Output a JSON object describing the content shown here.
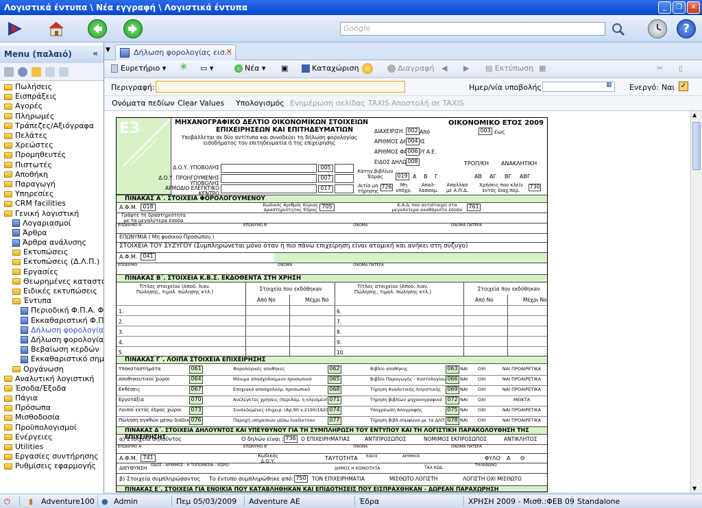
{
  "window": {
    "title": "Λογιστικά έντυπα \\ Νέα εγγραφή \\ Λογιστικά έντυπα"
  },
  "search": {
    "placeholder": "Google"
  },
  "sidebar": {
    "header": "Menu (παλαιό)",
    "items": [
      {
        "label": "Πωλήσεις",
        "level": 0,
        "type": "folder"
      },
      {
        "label": "Εισπράξεις",
        "level": 0,
        "type": "folder"
      },
      {
        "label": "Αγορές",
        "level": 0,
        "type": "folder"
      },
      {
        "label": "Πληρωμές",
        "level": 0,
        "type": "folder"
      },
      {
        "label": "Τράπεζες/Αξιόγραφα",
        "level": 0,
        "type": "folder"
      },
      {
        "label": "Πελάτες",
        "level": 0,
        "type": "folder"
      },
      {
        "label": "Χρεώστες",
        "level": 0,
        "type": "folder"
      },
      {
        "label": "Προμηθευτές",
        "level": 0,
        "type": "folder"
      },
      {
        "label": "Πιστωτές",
        "level": 0,
        "type": "folder"
      },
      {
        "label": "Αποθήκη",
        "level": 0,
        "type": "folder"
      },
      {
        "label": "Παραγωγή",
        "level": 0,
        "type": "folder"
      },
      {
        "label": "Υπηρεσίες",
        "level": 0,
        "type": "folder"
      },
      {
        "label": "CRM facilities",
        "level": 0,
        "type": "folder"
      },
      {
        "label": "Γενική λογιστική",
        "level": 0,
        "type": "folder"
      },
      {
        "label": "Λογαριασμοί",
        "level": 1,
        "type": "doc"
      },
      {
        "label": "Άρθρα",
        "level": 1,
        "type": "doc"
      },
      {
        "label": "Άρθρα ανάλυσης",
        "level": 1,
        "type": "doc"
      },
      {
        "label": "Εκτυπώσεις",
        "level": 1,
        "type": "folder"
      },
      {
        "label": "Εκτυπώσεις (Δ.Λ.Π.)",
        "level": 1,
        "type": "folder"
      },
      {
        "label": "Εργασίες",
        "level": 1,
        "type": "folder"
      },
      {
        "label": "Θεωρημένες καταστάσεις",
        "level": 1,
        "type": "folder"
      },
      {
        "label": "Ειδικές εκτυπώσεις",
        "level": 1,
        "type": "folder"
      },
      {
        "label": "Έντυπα",
        "level": 1,
        "type": "folder"
      },
      {
        "label": "Περιοδική Φ.Π.Α. Φ",
        "level": 2,
        "type": "doc"
      },
      {
        "label": "Εκκαθαριστική Φ.Π",
        "level": 2,
        "type": "doc"
      },
      {
        "label": "Δήλωση φορολογία",
        "level": 2,
        "type": "doc",
        "selected": true
      },
      {
        "label": "Δήλωση φορολογία",
        "level": 2,
        "type": "doc"
      },
      {
        "label": "Βεβαίωση κερδών",
        "level": 2,
        "type": "doc"
      },
      {
        "label": "Εκκαθαριστικό σημ",
        "level": 2,
        "type": "doc"
      },
      {
        "label": "Οργάνωση",
        "level": 1,
        "type": "folder"
      },
      {
        "label": "Αναλυτική λογιστική",
        "level": 0,
        "type": "folder"
      },
      {
        "label": "Έσοδα/Έξοδα",
        "level": 0,
        "type": "folder"
      },
      {
        "label": "Πάγια",
        "level": 0,
        "type": "folder"
      },
      {
        "label": "Πρόσωπα",
        "level": 0,
        "type": "folder"
      },
      {
        "label": "Μισθοδοσία",
        "level": 0,
        "type": "folder"
      },
      {
        "label": "Προϋπολογισμοί",
        "level": 0,
        "type": "folder"
      },
      {
        "label": "Ενέργειες",
        "level": 0,
        "type": "folder"
      },
      {
        "label": "Utilities",
        "level": 0,
        "type": "folder"
      },
      {
        "label": "Εργασίες συντήρησης",
        "level": 0,
        "type": "folder"
      },
      {
        "label": "Ρυθμίσεις εφαρμογής",
        "level": 0,
        "type": "folder"
      }
    ]
  },
  "tab": {
    "label": "Δήλωση φορολογίας εισ..."
  },
  "toolbar": {
    "index": "Ευρετήριο",
    "new": "Νέα",
    "save": "Καταχώριση",
    "delete": "Διαγραφή",
    "print": "Εκτύπωση"
  },
  "descbar": {
    "desc_label": "Περιγραφή:",
    "desc_value": "",
    "date_label": "Ημερ/νία υποβολής:",
    "date_value": "",
    "active_label": "Ενεργό:",
    "active_value": "Ναι"
  },
  "actions": {
    "field_names": "Ονόματα πεδίων",
    "clear": "Clear Values",
    "calc": "Υπολογισμός",
    "update_taxis": "Ενημέρωση σελίδας TAXIS",
    "send_taxis": "Αποστολή σε TAXIS"
  },
  "form": {
    "title1": "ΜΗΧΑΝΟΓΡΑΦΙΚΟ ΔΕΛΤΙΟ ΟΙΚΟΝΟΜΙΚΩΝ ΣΤΟΙΧΕΙΩΝ",
    "title2": "ΕΠΙΧΕΙΡΗΣΕΩΝ ΚΑΙ ΕΠΙΤΗΔΕΥΜΑΤΙΩΝ",
    "year": "ΟΙΚΟΝΟΜΙΚΟ ΕΤΟΣ 2009",
    "subtitle": "Υποβάλλεται σε δύο αντίτυπα και συνοδεύει τη δήλωση φορολογίας εισοδήματος του επιτηδευματία ή της επιχείρησης",
    "logo": "E3",
    "doy_labels": [
      "Δ.Ο.Υ. ΥΠΟΒΟΛΗΣ",
      "Δ.Ο.Υ. ΠΡΟΗΓΟΥΜΕΝΗΣ ΥΠΟΒΟΛΗΣ",
      "ΑΡΜΟΔΙΟ ΕΛΕΓΚΤΙΚΟ ΚΕΝΤΡΟ"
    ],
    "doy_codes": [
      "005",
      "007",
      "017"
    ],
    "right_labels": [
      "ΔΙΑΧΕΙΡΙΣΗ",
      "ΑΡΙΘΜΟΣ ΔΗΛΩΣΗΣ",
      "ΑΡΙΘΜΟΣ ΦΑΚΕΛΟΥ Α.Ε.",
      "ΕΙΔΟΣ ΔΗΛΩΣΗΣ"
    ],
    "right_codes": [
      "002",
      "004",
      "006",
      "008"
    ],
    "from": "Από",
    "to": "έως",
    "code003": "003",
    "tropikh": "ΤΡΟΠ/ΚΗ",
    "anaklitiki": "ΑΝΑΚΛΗΤΙΚΗ",
    "books_label": "Κατηγ.βιβλίων Έδρας",
    "books_code": "019",
    "books_cats": [
      "Α",
      "Β",
      "Γ"
    ],
    "misc_labels": [
      "Αιτία μη τήρησης",
      "Μη υπόχρ.",
      "Απαλ-λασσομ.",
      "Απαλλασ με Α.Π.Δ.",
      "Χρήσεις που κλείν εντός διαχ.περ."
    ],
    "code726": "726",
    "code730": "730",
    "codes_ab": [
      "ΑΒ",
      "ΑΓ",
      "ΒΓ",
      "ΑΒΓ"
    ],
    "pinA": "ΠΙΝΑΚΑΣ Α΄. ΣΤΟΙΧΕΙΑ ΦΟΡΟΛΟΓΟΥΜΕΝΟΥ",
    "afm_label": "Α.Φ.Μ.",
    "afm_code": "018",
    "kad_label": "Κωδικός Αριθμός Κύριας Δραστηριότητας Έδρας",
    "kad_code": "705",
    "kad2_label": "Κ.Α.Δ. που αντιστοιχεί στα μεγαλύτερα ακαθάριστα έσοδα",
    "kad2_code": "761",
    "activity": "Γράψτε τη δραστηριότητα με τα μεγαλύτερα έσοδα",
    "name_labels": [
      "ΕΠΩΝΥΜΟ Α'",
      "ΕΠΩΝΥΜΟ Β'",
      "ΟΝΟΜΑ",
      "ΟΝΟΜΑ ΠΑΤΕΡΑ"
    ],
    "eponymia": "ΕΠΩΝΥΜΙΑ ( Μη φυσικού Προσώπου )",
    "spouse": "ΣΤΟΙΧΕΙΑ ΤΟΥ ΣΥΖΥΓΟΥ (Συμπληρώνεται μόνο όταν η πιο πάνω επιχείρηση είναι ατομική και ανήκει στη σύζυγο)",
    "spouse_afm_code": "041",
    "spouse_name_labels": [
      "ΕΠΩΝΥΜΟ",
      "ΟΝΟΜΑ",
      "ΟΝΟΜΑ ΠΑΤΕΡΑ"
    ],
    "pinB": "ΠΙΝΑΚΑΣ Β΄. ΣΤΟΙΧΕΙΑ Κ.Β.Σ. ΕΚΔΟΘΕΝΤΑ ΣΤΗ ΧΡΗΣΗ",
    "pinB_title": "Τίτλος στοιχείου (Αποδ. λιαν. Πώλησης, τιμολ. πώλησης κτλ.)",
    "pinB_issued": "Στοιχεία που εκδόθηκαν",
    "pinB_from": "Από Νο",
    "pinB_to": "Μέχρι Νο",
    "pinB_rows_left": [
      "1.",
      "2.",
      "3.",
      "4.",
      "5."
    ],
    "pinB_rows_right": [
      "6.",
      "7.",
      "8.",
      "9.",
      "10."
    ],
    "pinG": "ΠΙΝΑΚΑΣ Γ΄. ΛΟΙΠΑ ΣΤΟΙΧΕΙΑ ΕΠΙΧΕΙΡΗΣΗΣ",
    "pinG_rows": [
      {
        "l": "Υποκαταστήματα",
        "lc": "061",
        "m": "Φορολογικές αποθήκες",
        "mc": "062",
        "r": "Βιβλίο αποθήκης",
        "rc": "063",
        "opt": "ΝΑΙ ΠΡΟΑΙΡΕΤΙΚΑ"
      },
      {
        "l": "Αποθηκευτικοί χώροι",
        "lc": "064",
        "m": "Μόνιμα απασχολούμενο προσωπικό",
        "mc": "065",
        "r": "Βιβλίο Παραγωγής - Κοστολογίου",
        "rc": "066",
        "opt": "ΝΑΙ ΠΡΟΑΙΡΕΤΙΚΑ"
      },
      {
        "l": "Εκθέσεις",
        "lc": "067",
        "m": "Εποχιακά απασχολούμ. προσωπικό",
        "mc": "068",
        "r": "Τήρηση Αναλυτικής Λογιστικής",
        "rc": "069",
        "opt": "ΝΑΙ ΠΡΟΑΙΡΕΤΙΚΑ"
      },
      {
        "l": "Εργοτάξια",
        "lc": "070",
        "m": "Ανέλεγκτες χρήσεις (περιλαμ. η κλειόμενη)",
        "mc": "071",
        "r": "Τήρηση βιβλίων μηχανογραφικά",
        "rc": "072",
        "opt": "ΜΕΙΚΤΑ"
      },
      {
        "l": "Λοιποί εκτός έδρας χώροι",
        "lc": "073",
        "m": "Συνδεδεμένες επιχειρ. (Αρ.90 ν.2190/1920)",
        "mc": "074",
        "r": "Υποχρέωση Απογραφής",
        "rc": "075",
        "opt": "ΝΑΙ ΠΡΟΑΙΡΕΤΙΚΑ"
      },
      {
        "l": "Πώληση αγαθών μέσω διαδικτύου",
        "lc": "076",
        "m": "Παροχή υπηρεσιών μέσω διαδικτύου",
        "mc": "077",
        "r": "Τήρηση βιβλ.σύμφωνα με τα ΔΛΠ",
        "rc": "078",
        "opt": "ΝΑΙ ΠΡΟΑΙΡΕΤΙΚΑ"
      }
    ],
    "nai": "ΝΑΙ",
    "oxi": "ΟΧΙ",
    "pinD": "ΠΙΝΑΚΑΣ Δ΄. ΣΤΟΙΧΕΙΑ ΔΗΛΟΥΝΤΟΣ ΚΑΙ ΥΠΕΥΘΥΝΟΥ ΓΙΑ ΤΗ ΣΥΜΠΛΗΡΩΣΗ ΤΟΥ ΕΝΤΥΠΟΥ ΚΑΙ ΤΗ ΛΟΓΙΣΤΙΚΗ ΠΑΡΑΚΟΛΟΥΘΗΣΗ ΤΗΣ ΕΠΙΧΕΙΡΗΣΗΣ",
    "pinD_decl": "α) Στοιχεία δηλούντος",
    "pinD_is": "Ο δηλών είναι :",
    "pinD_code": "736",
    "pinD_roles": [
      "Ο ΕΠΙΧΕΙΡΗΜΑΤΙΑΣ",
      "ΑΝΤΙΠΡΟΣΩΠΟΣ",
      "ΝΟΜΙΜΟΣ ΕΚΠΡΟΣΩΠΟΣ",
      "ΑΝΤΙΚΛΗΤΟΣ"
    ],
    "pinD_afm_code": "741",
    "pinD_doy": "Κωδικός Δ.Ο.Υ.",
    "pinD_id": "ΤΑΥΤΟΤΗΤΑ",
    "pinD_eidos": "ΕΙΔΟΣ",
    "pinD_arithmos": "ΑΡΙΘΜΟΣ",
    "pinD_fylo": "ΦΥΛΟ",
    "pinD_sex": [
      "Α",
      "Θ"
    ],
    "pinD_addr": "ΔΙΕΥΘΥΝΣΗ",
    "pinD_addr_sub": "ΟΔΟΣ - ΑΡΙΘΜΟΣ - Η ΤΟΠΟΘΕΣΙΑ - ΧΩΡΙΟ",
    "pinD_dimos": "ΔΗΜΟΣ Η ΚΟΙΝΟΤΗΤΑ",
    "pinD_tk": "ΤΑΧ ΚΩΔ",
    "pinD_tel": "ΤΗΛΕΦΩΝΟ",
    "pinD_b": "β) Στοιχεία συμπληρώσαντος",
    "pinD_b2": "Το έντυπο συμπληρώθηκε από:",
    "pinD_b_code": "750",
    "pinD_b_roles": [
      "ΤΟΝ ΕΠΙΧΕΙΡΗΜΑΤΙΑ",
      "ΜΙΣΘΩΤΟ ΛΟΓΙΣΤΗ",
      "ΛΟΓΙΣΤΗ ΟΧΙ ΜΙΣΘΩΤΟ"
    ],
    "pinE": "ΠΙΝΑΚΑΣ Ε΄. ΣΤΟΙΧΕΙΑ ΓΙΑ ΕΝΟΙΚΙΑ ΠΟΥ ΚΑΤΑΒΛΗΘΗΚΑΝ ΚΑΙ ΕΠΙΔΟΤΗΣΕΙΣ ΠΟΥ ΕΙΣΠΡΑΧΘΗΚΑΝ - ΔΩΡΕΑΝ ΠΑΡΑΧΩΡΗΣΗ"
  },
  "status": {
    "company": "Adventure100",
    "user": "Admin",
    "date": "Πεμ 05/03/2009",
    "firm": "Adventure AE",
    "branch": "Έδρα",
    "period": "ΧΡΗΣΗ 2009 - Μισθ.:ΦΕΒ 09",
    "mode": "Standalone"
  },
  "colors": {
    "title_bar": "#0848c8",
    "form_green": "#d8f2c8",
    "desc_border": "#e8a020"
  }
}
